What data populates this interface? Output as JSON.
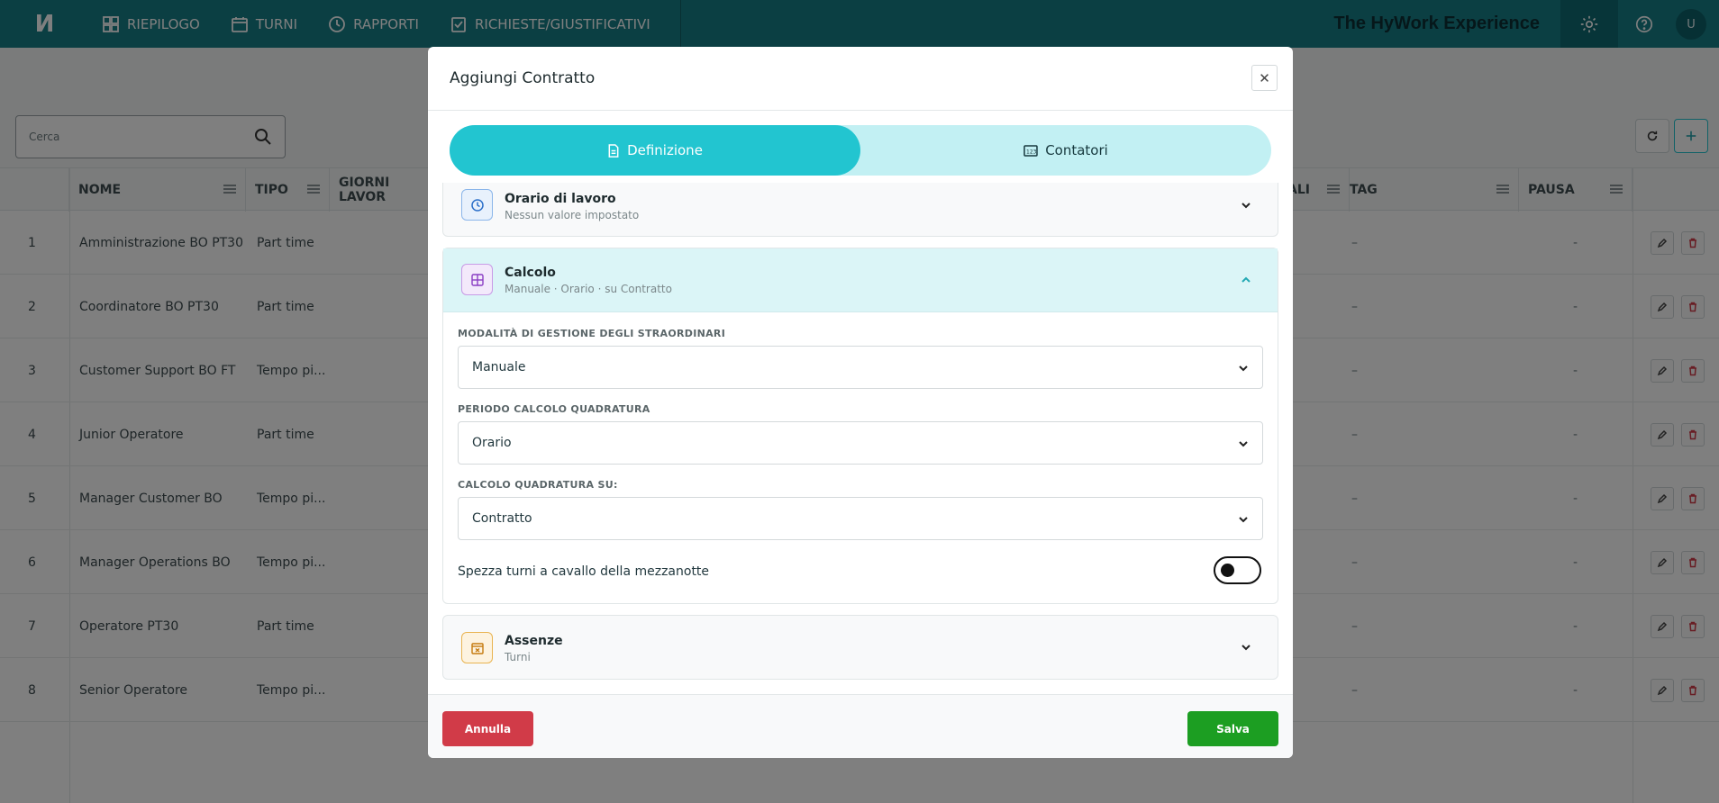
{
  "topbar": {
    "logo": "И",
    "nav": [
      {
        "label": "RIEPILOGO",
        "icon": "dashboard-icon"
      },
      {
        "label": "TURNI",
        "icon": "calendar-icon"
      },
      {
        "label": "RAPPORTI",
        "icon": "clock-icon"
      },
      {
        "label": "RICHIESTE/GIUSTIFICATIVI",
        "icon": "checklist-icon"
      }
    ],
    "brand": "The HyWork Experience",
    "avatar": "U"
  },
  "page": {
    "search_placeholder": "Cerca",
    "columns": [
      "NOME",
      "TIPO",
      "GIORNI LAVOR",
      "ALI",
      "TAG",
      "PAUSA"
    ],
    "rows": [
      {
        "num": "1",
        "nome": "Amministrazione BO PT30",
        "tipo": "Part time",
        "tag": "–",
        "pausa": "-"
      },
      {
        "num": "2",
        "nome": "Coordinatore BO PT30",
        "tipo": "Part time",
        "tag": "–",
        "pausa": "-"
      },
      {
        "num": "3",
        "nome": "Customer Support BO FT",
        "tipo": "Tempo pi...",
        "tag": "–",
        "pausa": "-"
      },
      {
        "num": "4",
        "nome": "Junior Operatore",
        "tipo": "Part time",
        "tag": "–",
        "pausa": "-"
      },
      {
        "num": "5",
        "nome": "Manager Customer BO",
        "tipo": "Tempo pi...",
        "tag": "–",
        "pausa": "-"
      },
      {
        "num": "6",
        "nome": "Manager Operations BO",
        "tipo": "Tempo pi...",
        "tag": "–",
        "pausa": "-"
      },
      {
        "num": "7",
        "nome": "Operatore PT30",
        "tipo": "Part time",
        "tag": "–",
        "pausa": "-"
      },
      {
        "num": "8",
        "nome": "Senior Operatore",
        "tipo": "Tempo pi...",
        "tag": "–",
        "pausa": "-"
      }
    ]
  },
  "modal": {
    "title": "Aggiungi Contratto",
    "tabs": {
      "definizione": "Definizione",
      "contatori": "Contatori"
    },
    "sections": {
      "orario": {
        "title": "Orario di lavoro",
        "subtitle": "Nessun valore impostato"
      },
      "calcolo": {
        "title": "Calcolo",
        "subtitle": "Manuale · Orario · su Contratto"
      },
      "assenze": {
        "title": "Assenze",
        "subtitle": "Turni"
      }
    },
    "fields": {
      "straordinari": {
        "label": "MODALITÀ DI GESTIONE DEGLI STRAORDINARI",
        "value": "Manuale"
      },
      "periodo": {
        "label": "PERIODO CALCOLO QUADRATURA",
        "value": "Orario"
      },
      "calcolo_su": {
        "label": "CALCOLO QUADRATURA SU:",
        "value": "Contratto"
      },
      "spezza": {
        "label": "Spezza turni a cavallo della mezzanotte",
        "on": false
      }
    },
    "buttons": {
      "cancel": "Annulla",
      "save": "Salva"
    }
  },
  "colors": {
    "primary": "#177f86",
    "accent": "#22c5d0",
    "danger": "#d13b48",
    "success": "#1c9e22"
  }
}
